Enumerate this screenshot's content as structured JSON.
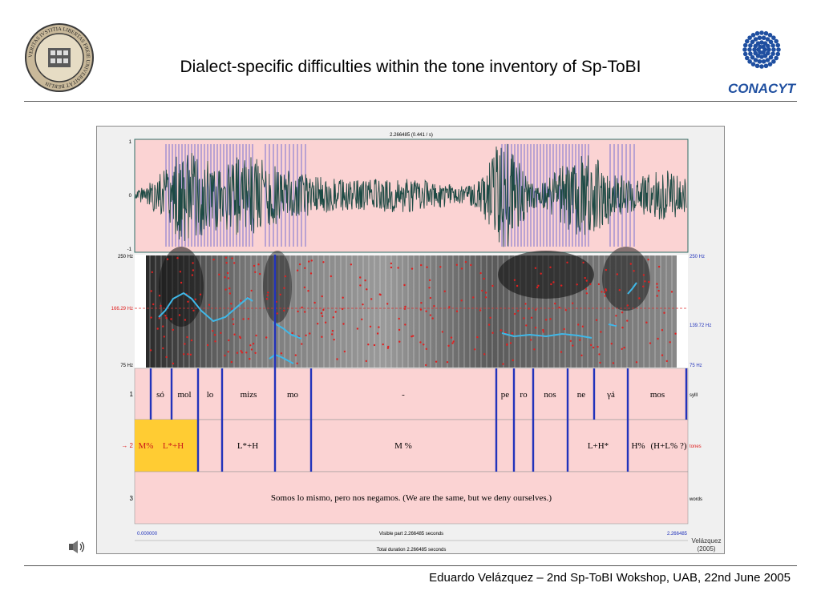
{
  "slide": {
    "title": "Dialect-specific difficulties within the tone inventory of Sp-ToBI",
    "footer": "Eduardo Velázquez – 2nd Sp-ToBI Wokshop, UAB, 22nd June 2005"
  },
  "icons": {
    "left_logo": "university-seal-logo",
    "right_logo": "conacyt-logo",
    "speaker": "speaker-icon"
  },
  "brand": {
    "right_logo_text": "CONACYT",
    "seal_text": "VERITAS IVSTITIA LIBERTAS FREIE UNIVERSITÄT BERLIN"
  },
  "praat": {
    "header": "2.266485 (0.441 / s)",
    "waveform": {
      "y_top": "1",
      "y_mid": "0",
      "y_bottom": "-1"
    },
    "pitch": {
      "top_left": "250 Hz",
      "top_right": "250 Hz",
      "mid_left": "166.29 Hz",
      "mid_right": "139.72 Hz",
      "bottom_left": "75 Hz",
      "bottom_right": "75 Hz"
    },
    "tiers": [
      {
        "number": "1",
        "name": "sylll"
      },
      {
        "number": "2",
        "name": "tones",
        "marker": "→"
      },
      {
        "number": "3",
        "name": "words"
      }
    ],
    "syllables": [
      "só",
      "mol",
      "lo",
      "mizs",
      "mo",
      "-",
      "pe",
      "ro",
      "nos",
      "ne",
      "γá",
      "mos"
    ],
    "tones": [
      "M%",
      "L*+H",
      "L*+H",
      "M %",
      "L+H*",
      "H%",
      "(H+L% ?)"
    ],
    "words": "Somos lo mismo, pero nos negamos. (We are the same, but we deny ourselves.)",
    "time_start": "0.000000",
    "time_end": "2.266485",
    "visible_part": "Visible part 2.266485 seconds",
    "total_duration": "Total duration 2.266485 seconds",
    "credit_line1": "Velázquez",
    "credit_line2": "(2005)"
  },
  "colors": {
    "pink": "#fbd3d3",
    "waveform": "#1d4a44",
    "pulse": "#5a5ad0",
    "boundary": "#2233bb",
    "pitch_curve": "#3fb8e8",
    "formant_dots": "#e02020",
    "selection": "#ffcc33"
  }
}
